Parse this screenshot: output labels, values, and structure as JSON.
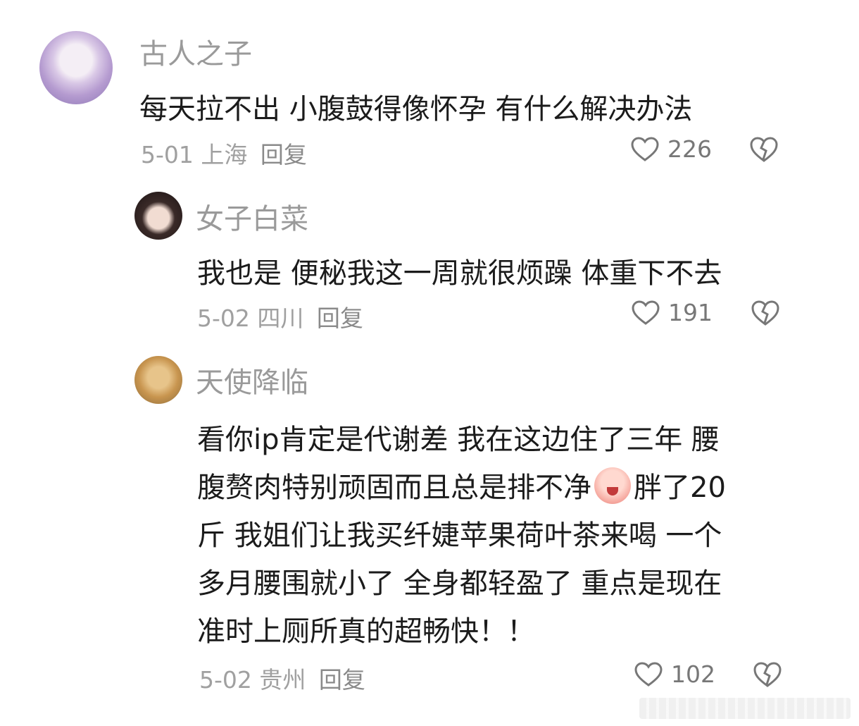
{
  "comments": [
    {
      "username": "古人之子",
      "text": "每天拉不出 小腹鼓得像怀孕 有什么解决办法",
      "date": "5-01",
      "location": "上海",
      "reply_label": "回复",
      "likes": "226"
    },
    {
      "username": "女子白菜",
      "text": "我也是 便秘我这一周就很烦躁 体重下不去",
      "date": "5-02",
      "location": "四川",
      "reply_label": "回复",
      "likes": "191"
    },
    {
      "username": "天使降临",
      "text_lines": [
        "看你ip肯定是代谢差 我在这边住了三年 腰",
        "腹赘肉特别顽固而且总是排不净",
        "胖了20",
        "斤 我姐们让我买纤婕苹果荷叶茶来喝 一个",
        "多月腰围就小了 全身都轻盈了 重点是现在",
        "准时上厕所真的超畅快！！"
      ],
      "date": "5-02",
      "location": "贵州",
      "reply_label": "回复",
      "likes": "102"
    }
  ],
  "icons": {
    "like": "heart-outline-icon",
    "dislike": "broken-heart-icon",
    "emoji": "crying-face-emoji"
  }
}
